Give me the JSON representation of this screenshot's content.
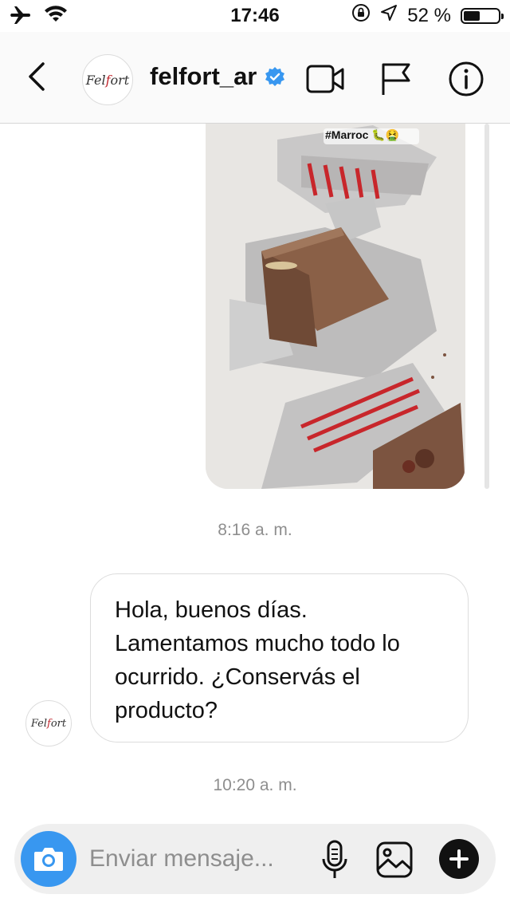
{
  "status_bar": {
    "time": "17:46",
    "battery_text": "52 %",
    "battery_level": 0.52,
    "icons": [
      "airplane-icon",
      "wifi-icon",
      "orientation-lock-icon",
      "location-icon",
      "battery-icon"
    ]
  },
  "header": {
    "username": "felfort_ar",
    "verified": true,
    "avatar_logo_text": "Felfort",
    "icons": [
      "back-icon",
      "video-call-icon",
      "flag-icon",
      "info-icon"
    ]
  },
  "messages": [
    {
      "type": "shared_photo",
      "sender": "user",
      "tag_text": "#Marroc 🐛🤮"
    },
    {
      "type": "timestamp",
      "text": "8:16 a. m."
    },
    {
      "type": "text",
      "sender": "felfort_ar",
      "text": "Hola, buenos días. Lamentamos mucho todo lo ocurrido. ¿Conservás el producto?"
    },
    {
      "type": "timestamp",
      "text": "10:20 a. m."
    }
  ],
  "composer": {
    "placeholder": "Enviar mensaje...",
    "icons": [
      "camera-icon",
      "microphone-icon",
      "gallery-icon",
      "plus-icon"
    ]
  },
  "colors": {
    "accent": "#3897f0",
    "verified_badge": "#3897f0",
    "timestamp_text": "#8e8e8e",
    "bubble_border": "#dcdcdc",
    "composer_bg": "#efefef"
  }
}
